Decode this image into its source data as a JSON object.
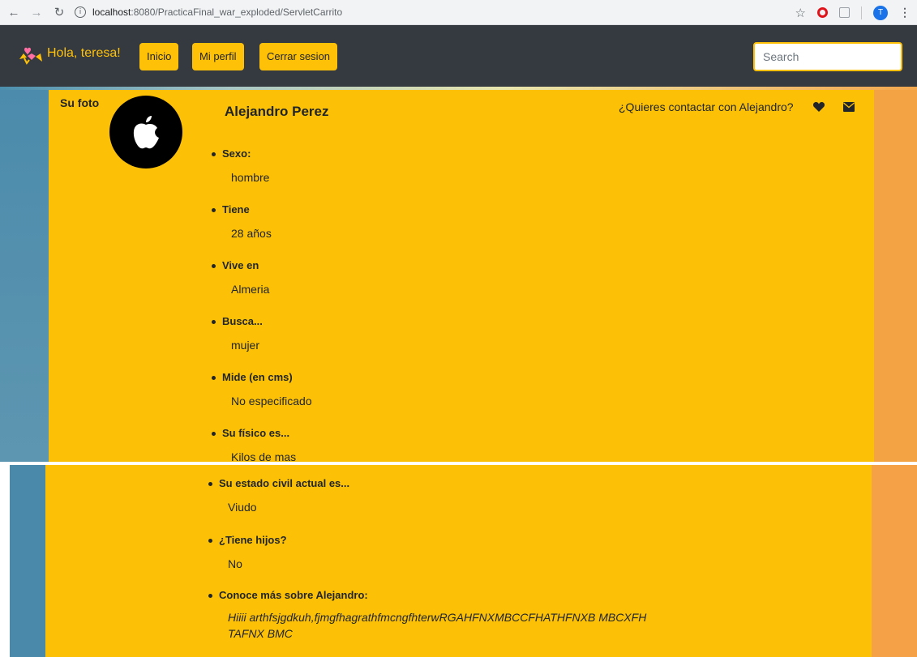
{
  "browser": {
    "url_host": "localhost",
    "url_path": ":8080/PracticaFinal_war_exploded/ServletCarrito",
    "profile_initial": "T"
  },
  "navbar": {
    "greeting": "Hola, teresa!",
    "buttons": [
      "Inicio",
      "Mi perfil",
      "Cerrar sesion"
    ],
    "search_placeholder": "Search"
  },
  "profile": {
    "photo_label": "Su foto",
    "name": "Alejandro Perez",
    "contact_prompt": "¿Quieres contactar con Alejandro?",
    "fields": [
      {
        "title": "Sexo:",
        "value": "hombre"
      },
      {
        "title": "Tiene",
        "value": "28 años"
      },
      {
        "title": "Vive en",
        "value": "Almeria"
      },
      {
        "title": "Busca...",
        "value": "mujer"
      },
      {
        "title": "Mide (en cms)",
        "value": "No especificado"
      },
      {
        "title": "Su físico es...",
        "value": "Kilos de mas"
      },
      {
        "title": "Su estado civil actual es...",
        "value": "Viudo"
      },
      {
        "title": "¿Tiene hijos?",
        "value": "No"
      },
      {
        "title": "Conoce más sobre Alejandro:",
        "value": "Hiiii arthfsjgdkuh,fjmgfhagrathfmcngfhterwRGAHFNXMBCCFHATHFNXB MBCXFHTAFNX BMC"
      }
    ]
  },
  "colors": {
    "navbar": "#343a40",
    "accent": "#ffc107",
    "panel": "#fcc107",
    "side_left": "#4b8aab",
    "side_right": "#f3a244"
  },
  "icons": [
    "back-icon",
    "forward-icon",
    "reload-icon",
    "info-icon",
    "star-icon",
    "opera-icon",
    "extension-icon",
    "profile-avatar",
    "menu-icon",
    "brand-logo",
    "apple-icon",
    "heart-icon",
    "mail-icon"
  ]
}
